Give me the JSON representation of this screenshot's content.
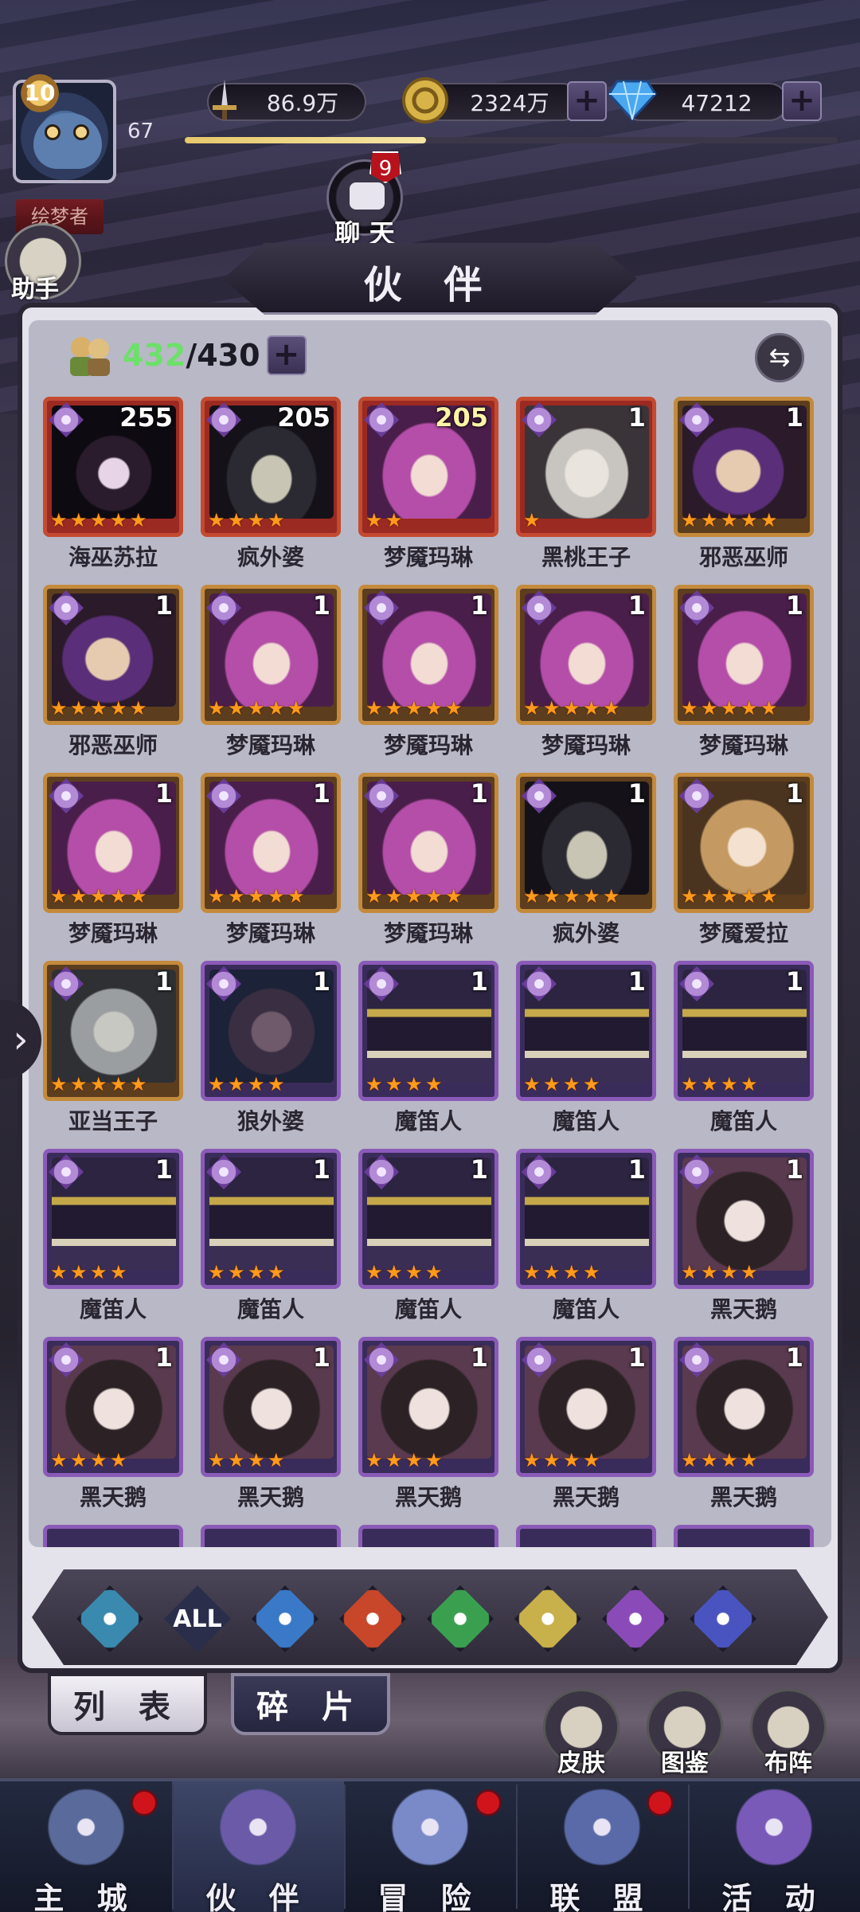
{
  "player": {
    "level": "10",
    "exp_level": "67",
    "title": "绘梦者",
    "exp_progress": 0.37
  },
  "resources": {
    "power": "86.9万",
    "gold": "2324万",
    "gems": "47212"
  },
  "assistant_label": "助手",
  "chat": {
    "label": "聊 天",
    "badge": "9"
  },
  "panel": {
    "title": "伙 伴",
    "count_current": "432",
    "count_sep": "/430"
  },
  "heroes": [
    {
      "name": "海巫苏拉",
      "level": "255",
      "stars": 5,
      "rarity": "red",
      "portrait": "dark"
    },
    {
      "name": "疯外婆",
      "level": "205",
      "stars": 4,
      "rarity": "red",
      "portrait": "witch"
    },
    {
      "name": "梦魇玛琳",
      "level": "205",
      "stars": 2,
      "rarity": "red",
      "portrait": "pink"
    },
    {
      "name": "黑桃王子",
      "level": "1",
      "stars": 1,
      "rarity": "red",
      "portrait": "white"
    },
    {
      "name": "邪恶巫师",
      "level": "1",
      "stars": 5,
      "rarity": "gold",
      "portrait": "sorc"
    },
    {
      "name": "邪恶巫师",
      "level": "1",
      "stars": 5,
      "rarity": "gold",
      "portrait": "sorc"
    },
    {
      "name": "梦魇玛琳",
      "level": "1",
      "stars": 5,
      "rarity": "gold",
      "portrait": "pink"
    },
    {
      "name": "梦魇玛琳",
      "level": "1",
      "stars": 5,
      "rarity": "gold",
      "portrait": "pink"
    },
    {
      "name": "梦魇玛琳",
      "level": "1",
      "stars": 5,
      "rarity": "gold",
      "portrait": "pink"
    },
    {
      "name": "梦魇玛琳",
      "level": "1",
      "stars": 5,
      "rarity": "gold",
      "portrait": "pink"
    },
    {
      "name": "梦魇玛琳",
      "level": "1",
      "stars": 5,
      "rarity": "gold",
      "portrait": "pink"
    },
    {
      "name": "梦魇玛琳",
      "level": "1",
      "stars": 5,
      "rarity": "gold",
      "portrait": "pink"
    },
    {
      "name": "梦魇玛琳",
      "level": "1",
      "stars": 5,
      "rarity": "gold",
      "portrait": "pink"
    },
    {
      "name": "疯外婆",
      "level": "1",
      "stars": 5,
      "rarity": "gold",
      "portrait": "witch"
    },
    {
      "name": "梦魇爱拉",
      "level": "1",
      "stars": 5,
      "rarity": "gold",
      "portrait": "blonde"
    },
    {
      "name": "亚当王子",
      "level": "1",
      "stars": 5,
      "rarity": "gold",
      "portrait": "old"
    },
    {
      "name": "狼外婆",
      "level": "1",
      "stars": 4,
      "rarity": "purple",
      "portrait": "wolf"
    },
    {
      "name": "魔笛人",
      "level": "1",
      "stars": 4,
      "rarity": "purple",
      "portrait": "piper"
    },
    {
      "name": "魔笛人",
      "level": "1",
      "stars": 4,
      "rarity": "purple",
      "portrait": "piper"
    },
    {
      "name": "魔笛人",
      "level": "1",
      "stars": 4,
      "rarity": "purple",
      "portrait": "piper"
    },
    {
      "name": "魔笛人",
      "level": "1",
      "stars": 4,
      "rarity": "purple",
      "portrait": "piper"
    },
    {
      "name": "魔笛人",
      "level": "1",
      "stars": 4,
      "rarity": "purple",
      "portrait": "piper"
    },
    {
      "name": "魔笛人",
      "level": "1",
      "stars": 4,
      "rarity": "purple",
      "portrait": "piper"
    },
    {
      "name": "魔笛人",
      "level": "1",
      "stars": 4,
      "rarity": "purple",
      "portrait": "piper"
    },
    {
      "name": "黑天鹅",
      "level": "1",
      "stars": 4,
      "rarity": "purple",
      "portrait": "swan"
    },
    {
      "name": "黑天鹅",
      "level": "1",
      "stars": 4,
      "rarity": "purple",
      "portrait": "swan"
    },
    {
      "name": "黑天鹅",
      "level": "1",
      "stars": 4,
      "rarity": "purple",
      "portrait": "swan"
    },
    {
      "name": "黑天鹅",
      "level": "1",
      "stars": 4,
      "rarity": "purple",
      "portrait": "swan"
    },
    {
      "name": "黑天鹅",
      "level": "1",
      "stars": 4,
      "rarity": "purple",
      "portrait": "swan"
    },
    {
      "name": "黑天鹅",
      "level": "1",
      "stars": 4,
      "rarity": "purple",
      "portrait": "swan"
    }
  ],
  "filters": [
    {
      "icon": "chevron-up-icon",
      "color": "#3a8ab0"
    },
    {
      "label": "ALL",
      "color": "#2a2e4a"
    },
    {
      "icon": "water-drop-icon",
      "color": "#3a78c8"
    },
    {
      "icon": "fire-icon",
      "color": "#c8462a"
    },
    {
      "icon": "wind-icon",
      "color": "#3aa050"
    },
    {
      "icon": "sun-icon",
      "color": "#c8b04a"
    },
    {
      "icon": "moon-icon",
      "color": "#8a4ab8"
    },
    {
      "icon": "planet-icon",
      "color": "#4a54c0"
    }
  ],
  "tabs": {
    "list": "列 表",
    "fragments": "碎 片"
  },
  "side_buttons": {
    "skins": "皮肤",
    "codex": "图鉴",
    "formation": "布阵"
  },
  "nav": [
    {
      "label": "主 城",
      "badge": true
    },
    {
      "label": "伙 伴",
      "badge": false,
      "active": true
    },
    {
      "label": "冒 险",
      "badge": true
    },
    {
      "label": "联 盟",
      "badge": true
    },
    {
      "label": "活 动",
      "badge": false
    }
  ]
}
